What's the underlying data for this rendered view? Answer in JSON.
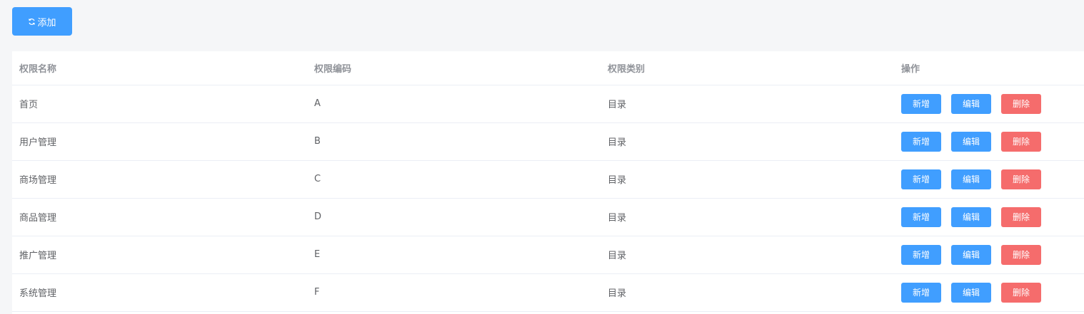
{
  "toolbar": {
    "add_label": "添加",
    "add_icon": "refresh-icon"
  },
  "table": {
    "headers": [
      "权限名称",
      "权限编码",
      "权限类别",
      "操作"
    ],
    "rows": [
      {
        "name": "首页",
        "code": "A",
        "type": "目录"
      },
      {
        "name": "用户管理",
        "code": "B",
        "type": "目录"
      },
      {
        "name": "商场管理",
        "code": "C",
        "type": "目录"
      },
      {
        "name": "商品管理",
        "code": "D",
        "type": "目录"
      },
      {
        "name": "推广管理",
        "code": "E",
        "type": "目录"
      },
      {
        "name": "系统管理",
        "code": "F",
        "type": "目录"
      }
    ],
    "actions": {
      "add": "新增",
      "edit": "编辑",
      "delete": "删除"
    }
  },
  "colors": {
    "primary": "#409eff",
    "danger": "#f56c6c",
    "background": "#f5f6f8"
  }
}
